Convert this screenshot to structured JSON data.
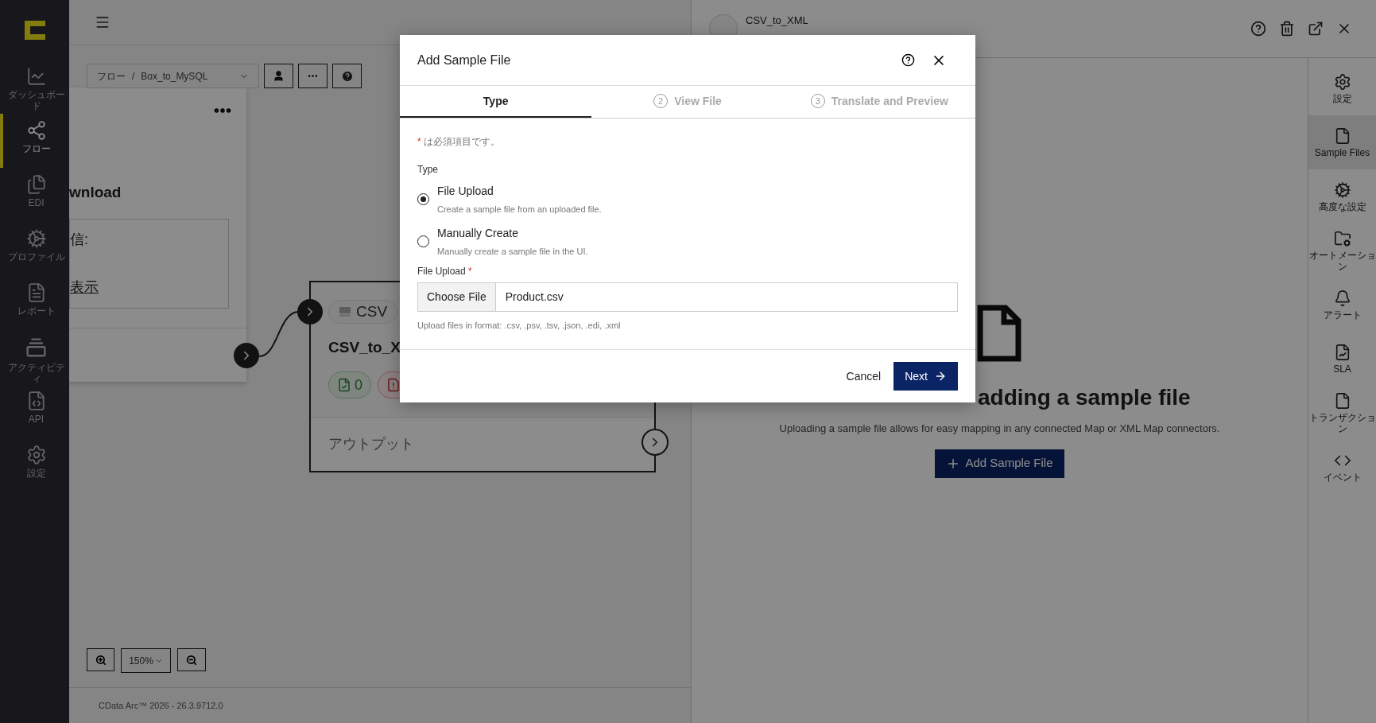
{
  "sidebar": {
    "items": [
      {
        "label": "ダッシュボード",
        "selected": false
      },
      {
        "label": "フロー",
        "selected": true
      },
      {
        "label": "EDI",
        "selected": false
      },
      {
        "label": "プロファイル",
        "selected": false
      },
      {
        "label": "レポート",
        "selected": false
      },
      {
        "label": "アクティビティ",
        "selected": false
      },
      {
        "label": "API",
        "selected": false
      },
      {
        "label": "設定",
        "selected": false
      }
    ]
  },
  "canvas": {
    "breadcrumb": {
      "path": "フロー",
      "separator": "/",
      "name": "Box_to_MySQL"
    },
    "source_card": {
      "title": "wnload",
      "fields": [
        {
          "kind": "label",
          "text": "信:"
        },
        {
          "kind": "link",
          "text": "表示"
        }
      ]
    },
    "target_card": {
      "type_chip": "CSV",
      "title": "CSV_to_X",
      "badges": [
        {
          "kind": "success",
          "count": "0"
        },
        {
          "kind": "error"
        }
      ],
      "output": "アウトプット"
    },
    "zoom": {
      "level": "150%"
    },
    "footer": "CData Arc™ 2026 - 26.3.9712.0"
  },
  "panel": {
    "title": "CSV_to_XML",
    "empty_state": {
      "heading": "adding a sample file",
      "description": "Uploading a sample file allows for easy mapping in any connected Map or XML Map connectors.",
      "button": "Add Sample File"
    },
    "rail": [
      {
        "label": "設定",
        "selected": false
      },
      {
        "label": "Sample Files",
        "selected": true
      },
      {
        "label": "高度な設定",
        "selected": false
      },
      {
        "label": "オートメーション",
        "selected": false
      },
      {
        "label": "アラート",
        "selected": false
      },
      {
        "label": "SLA",
        "selected": false
      },
      {
        "label": "トランザクション",
        "selected": false
      },
      {
        "label": "イベント",
        "selected": false
      }
    ]
  },
  "dialog": {
    "title": "Add Sample File",
    "tabs": [
      {
        "label": "Type",
        "selected": true
      },
      {
        "number": "2",
        "label": "View File",
        "selected": false
      },
      {
        "number": "3",
        "label": "Translate and Preview",
        "selected": false
      }
    ],
    "required_note": {
      "mark": "*",
      "text": "は必須項目です。"
    },
    "type_label": "Type",
    "options": [
      {
        "label": "File Upload",
        "description": "Create a sample file from an uploaded file.",
        "selected": true
      },
      {
        "label": "Manually Create",
        "description": "Manually create a sample file in the UI.",
        "selected": false
      }
    ],
    "file_upload": {
      "label": "File Upload",
      "mark": "*",
      "button": "Choose File",
      "value": "Product.csv",
      "hint": "Upload files in format: .csv, .psv, .tsv, .json, .edi, .xml"
    },
    "buttons": {
      "cancel": "Cancel",
      "next": "Next"
    }
  }
}
